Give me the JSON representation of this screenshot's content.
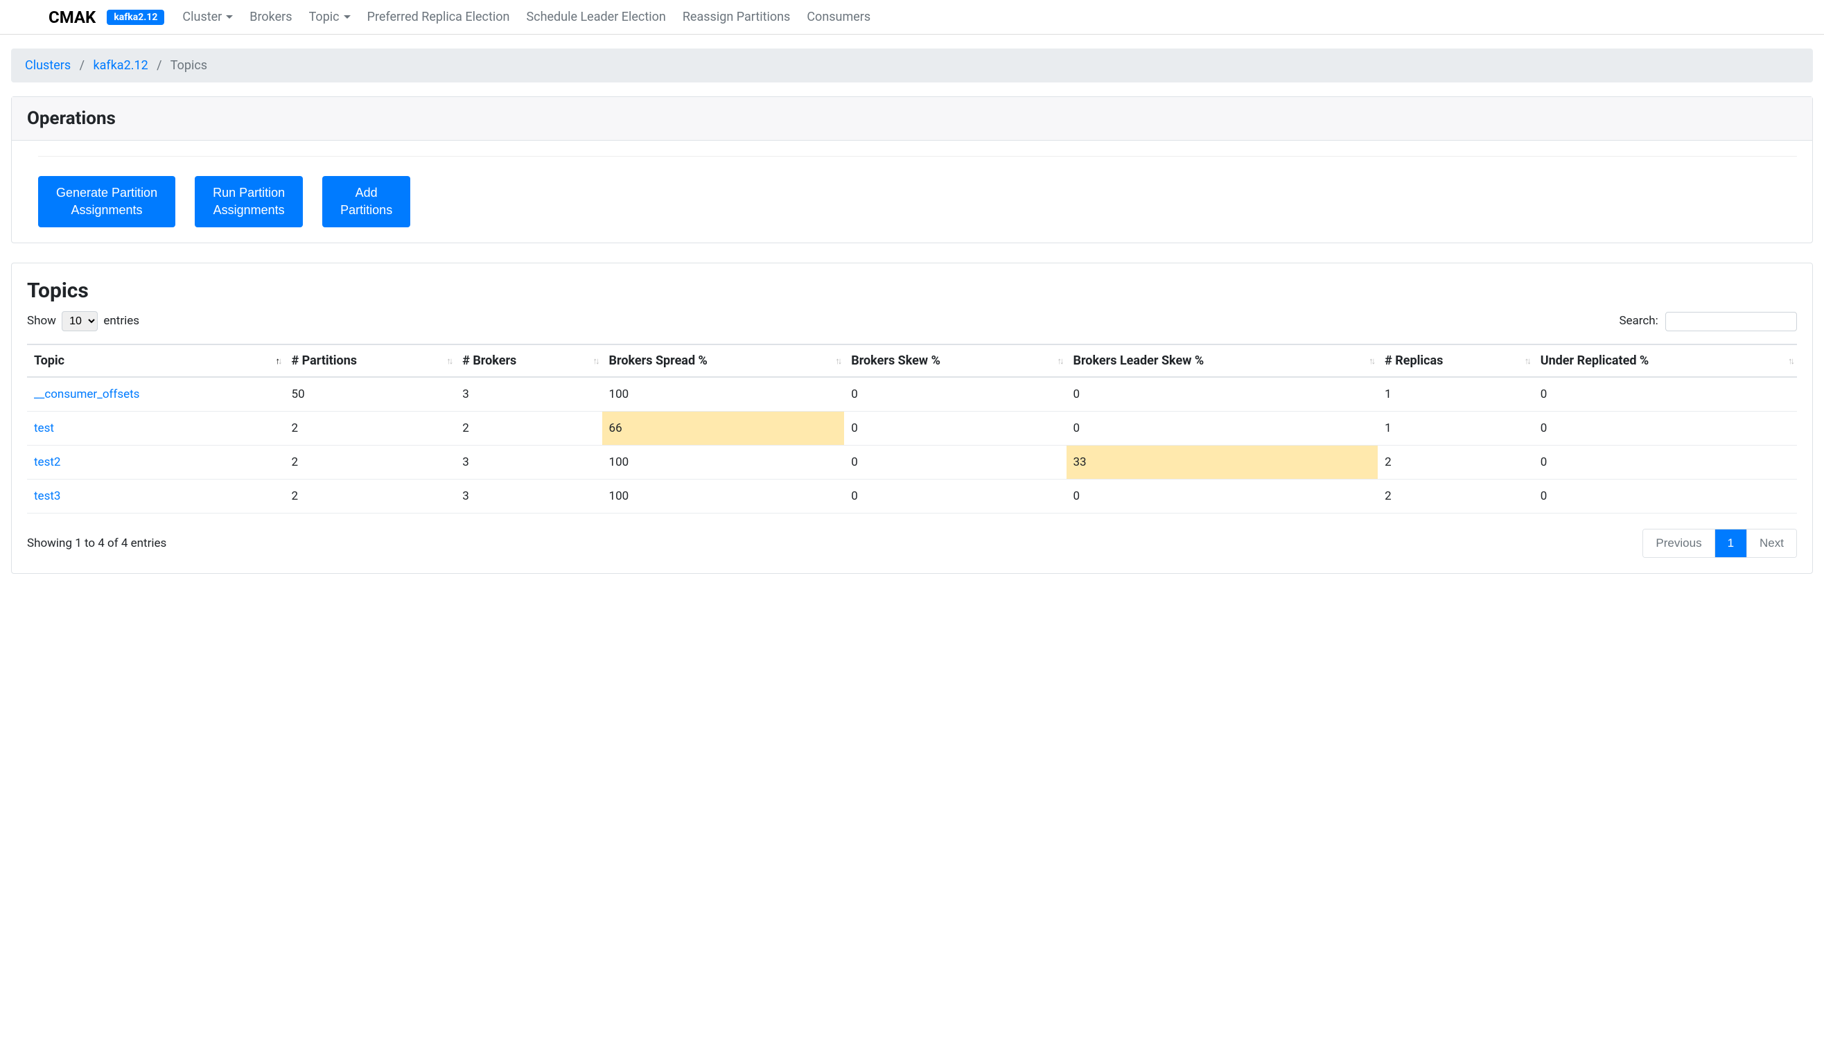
{
  "nav": {
    "brand": "CMAK",
    "cluster_badge": "kafka2.12",
    "items": [
      {
        "label": "Cluster",
        "dropdown": true
      },
      {
        "label": "Brokers",
        "dropdown": false
      },
      {
        "label": "Topic",
        "dropdown": true
      },
      {
        "label": "Preferred Replica Election",
        "dropdown": false
      },
      {
        "label": "Schedule Leader Election",
        "dropdown": false
      },
      {
        "label": "Reassign Partitions",
        "dropdown": false
      },
      {
        "label": "Consumers",
        "dropdown": false
      }
    ]
  },
  "breadcrumb": {
    "items": [
      {
        "label": "Clusters",
        "link": true
      },
      {
        "label": "kafka2.12",
        "link": true
      },
      {
        "label": "Topics",
        "link": false
      }
    ]
  },
  "operations": {
    "title": "Operations",
    "buttons": [
      "Generate Partition Assignments",
      "Run Partition Assignments",
      "Add Partitions"
    ]
  },
  "topics": {
    "title": "Topics",
    "length_label_pre": "Show",
    "length_value": "10",
    "length_label_post": "entries",
    "search_label": "Search:",
    "search_value": "",
    "columns": [
      "Topic",
      "# Partitions",
      "# Brokers",
      "Brokers Spread %",
      "Brokers Skew %",
      "Brokers Leader Skew %",
      "# Replicas",
      "Under Replicated %"
    ],
    "rows": [
      {
        "topic": "__consumer_offsets",
        "partitions": "50",
        "brokers": "3",
        "spread": "100",
        "spread_warn": false,
        "skew": "0",
        "leader_skew": "0",
        "leader_skew_warn": false,
        "replicas": "1",
        "under": "0"
      },
      {
        "topic": "test",
        "partitions": "2",
        "brokers": "2",
        "spread": "66",
        "spread_warn": true,
        "skew": "0",
        "leader_skew": "0",
        "leader_skew_warn": false,
        "replicas": "1",
        "under": "0"
      },
      {
        "topic": "test2",
        "partitions": "2",
        "brokers": "3",
        "spread": "100",
        "spread_warn": false,
        "skew": "0",
        "leader_skew": "33",
        "leader_skew_warn": true,
        "replicas": "2",
        "under": "0"
      },
      {
        "topic": "test3",
        "partitions": "2",
        "brokers": "3",
        "spread": "100",
        "spread_warn": false,
        "skew": "0",
        "leader_skew": "0",
        "leader_skew_warn": false,
        "replicas": "2",
        "under": "0"
      }
    ],
    "info": "Showing 1 to 4 of 4 entries",
    "pagination": {
      "prev": "Previous",
      "page": "1",
      "next": "Next"
    }
  }
}
